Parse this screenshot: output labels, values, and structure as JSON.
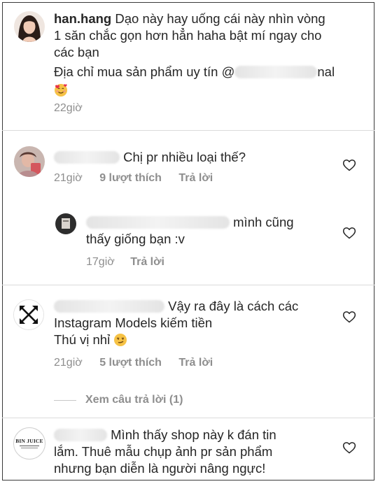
{
  "post": {
    "username": "han.hang",
    "caption_line1": " Dạo này hay uống cái này nhìn vòng",
    "caption_line2": "1 săn chắc gọn hơn hẳn haha bật mí ngay cho",
    "caption_line3": "các bạn",
    "address_prefix": "Địa chỉ mua sản phẩm uy tín @",
    "address_suffix": "nal",
    "time": "22giờ"
  },
  "comments": [
    {
      "text": "Chị pr nhiều loại thế?",
      "time": "21giờ",
      "likes": "9 lượt thích",
      "reply_label": "Trả lời"
    },
    {
      "text_line1": "mình cũng",
      "text_line2": "thấy giống bạn :v",
      "time": "17giờ",
      "reply_label": "Trả lời"
    },
    {
      "text_line1": "Vậy ra đây là cách các",
      "text_line2": "Instagram Models kiếm tiền",
      "text_line3": "Thú vị nhỉ",
      "time": "21giờ",
      "likes": "5 lượt thích",
      "reply_label": "Trả lời",
      "view_replies": "Xem câu trả lời (1)"
    },
    {
      "avatar_logo": "BIN JUICE",
      "text_line1": "Mình thấy shop này k đán tin",
      "text_line2": "lắm. Thuê mẫu chụp ảnh pr sản phẩm",
      "text_line3": "nhưng bạn diễn là người nâng ngực!"
    }
  ],
  "icons": {
    "heart": "heart-outline-icon",
    "emoji_hearts": "smiling-face-with-hearts-icon",
    "emoji_smirk": "smirking-face-icon"
  },
  "colors": {
    "text": "#262626",
    "meta": "#8e8e8e",
    "divider": "#dbdbdb"
  }
}
